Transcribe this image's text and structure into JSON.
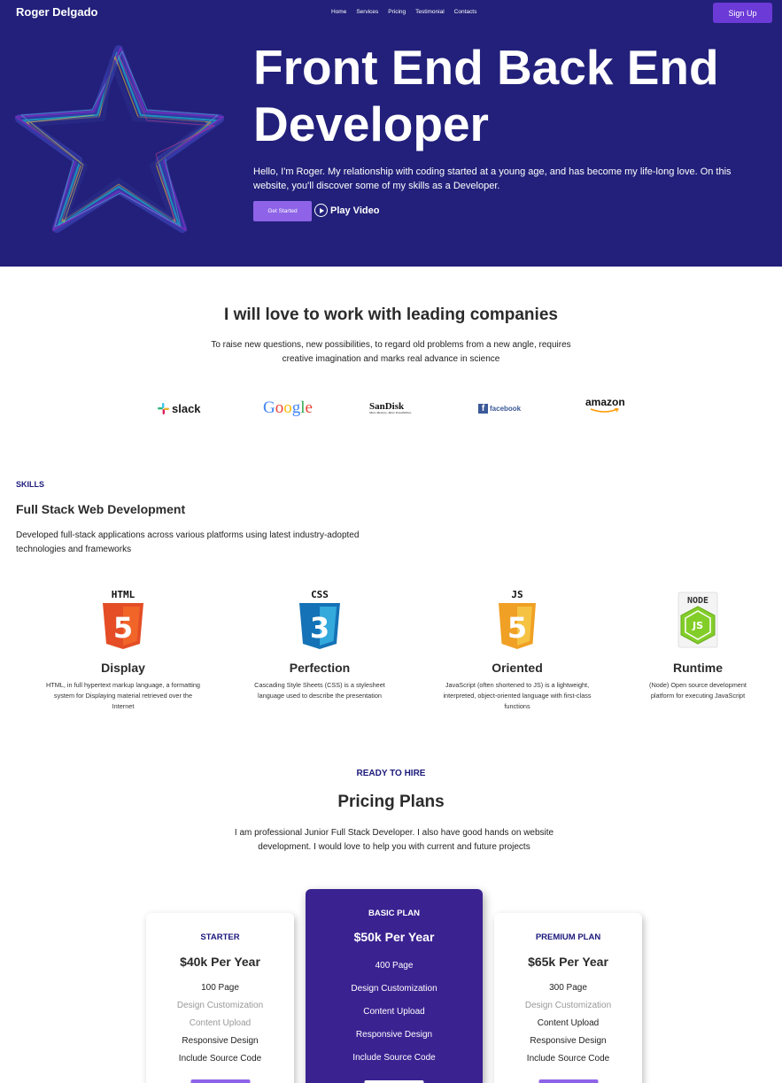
{
  "header": {
    "brand": "Roger Delgado",
    "nav": [
      "Home",
      "Services",
      "Pricing",
      "Testimonial",
      "Contacts"
    ],
    "signup_label": "Sign Up"
  },
  "hero": {
    "title": "Front End Back End Developer",
    "description": "Hello, I'm Roger. My relationship with coding started at a young age, and has become my life-long love. On this website, you'll discover some of my skills as a Developer.",
    "cta_label": "Get Started",
    "play_label": "Play Video"
  },
  "companies": {
    "title": "I will love to work with leading companies",
    "description": "To raise new questions, new possibilities, to regard old problems from a new angle, requires creative imagination and marks real advance in science",
    "logos": {
      "slack": "slack",
      "google": "Google",
      "sandisk": "SanDisk",
      "sandisk_tagline": "More Memory. More Possibilities.",
      "facebook": "facebook",
      "facebook_mark": "f",
      "amazon": "amazon"
    }
  },
  "skills": {
    "label": "SKILLS",
    "title": "Full Stack Web Development",
    "description": "Developed full-stack applications across various platforms using latest industry-adopted technologies and frameworks",
    "items": [
      {
        "badge": "HTML",
        "digit": "5",
        "name": "Display",
        "description": "HTML, in full hypertext markup language, a formatting system for Displaying material retrieved over the Internet",
        "color": "#e44d26"
      },
      {
        "badge": "CSS",
        "digit": "3",
        "name": "Perfection",
        "description": "Cascading Style Sheets (CSS) is a stylesheet language used to describe the presentation",
        "color": "#1572b6"
      },
      {
        "badge": "JS",
        "digit": "5",
        "name": "Oriented",
        "description": "JavaScript (often shortened to JS) is a lightweight, interpreted, object-oriented language with first-class functions",
        "color": "#f0a024"
      },
      {
        "badge": "NODE",
        "digit": "JS",
        "name": "Runtime",
        "description": "(Node) Open source development platform for executing JavaScript",
        "color": "#83cd29"
      }
    ]
  },
  "pricing": {
    "label": "READY TO HIRE",
    "title": "Pricing Plans",
    "description": "I am professional Junior Full Stack Developer. I also have good hands on website development. I would love to help you with current and future projects",
    "plans": [
      {
        "name": "STARTER",
        "price": "$40k Per Year",
        "features": [
          "100 Page",
          "Design Customization",
          "Content Upload",
          "Responsive Design",
          "Include Source Code"
        ]
      },
      {
        "name": "BASIC PLAN",
        "price": "$50k Per Year",
        "features": [
          "400 Page",
          "Design Customization",
          "Content Upload",
          "Responsive Design",
          "Include Source Code"
        ]
      },
      {
        "name": "PREMIUM PLAN",
        "price": "$65k Per Year",
        "features": [
          "300 Page",
          "Design Customization",
          "Content Upload",
          "Responsive Design",
          "Include Source Code"
        ]
      }
    ]
  },
  "colors": {
    "hero_bg": "#22207a",
    "accent": "#8e63e8",
    "signup": "#6c3ad7",
    "featured_card": "#3a2291",
    "label": "#1d1a7c"
  }
}
